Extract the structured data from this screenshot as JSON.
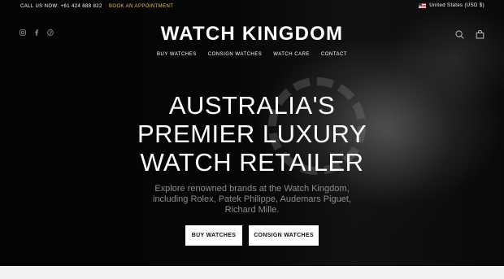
{
  "topbar": {
    "call_label": "CALL US NOW:",
    "phone": "+61 424 888 822",
    "appointment": "BOOK AN APPOINTMENT",
    "country": "United States (USD $)"
  },
  "header": {
    "logo": "WATCH KINGDOM",
    "social_icons": [
      "instagram-icon",
      "facebook-icon",
      "pinterest-icon"
    ],
    "right_icons": [
      "search-icon",
      "cart-icon"
    ]
  },
  "nav": {
    "items": [
      "BUY WATCHES",
      "CONSIGN WATCHES",
      "WATCH CARE",
      "CONTACT"
    ]
  },
  "hero": {
    "line1": "AUSTRALIA'S",
    "line2": "PREMIER LUXURY",
    "line3": "WATCH RETAILER",
    "subtitle": "Explore renowned brands at the Watch Kingdom, including Rolex, Patek Philippe, Audemars Piguet, Richard Mille.",
    "buttons": [
      "BUY WATCHES",
      "CONSIGN WATCHES"
    ]
  },
  "colors": {
    "accent": "#e6c15a",
    "background": "#000000",
    "button_bg": "#ffffff"
  }
}
